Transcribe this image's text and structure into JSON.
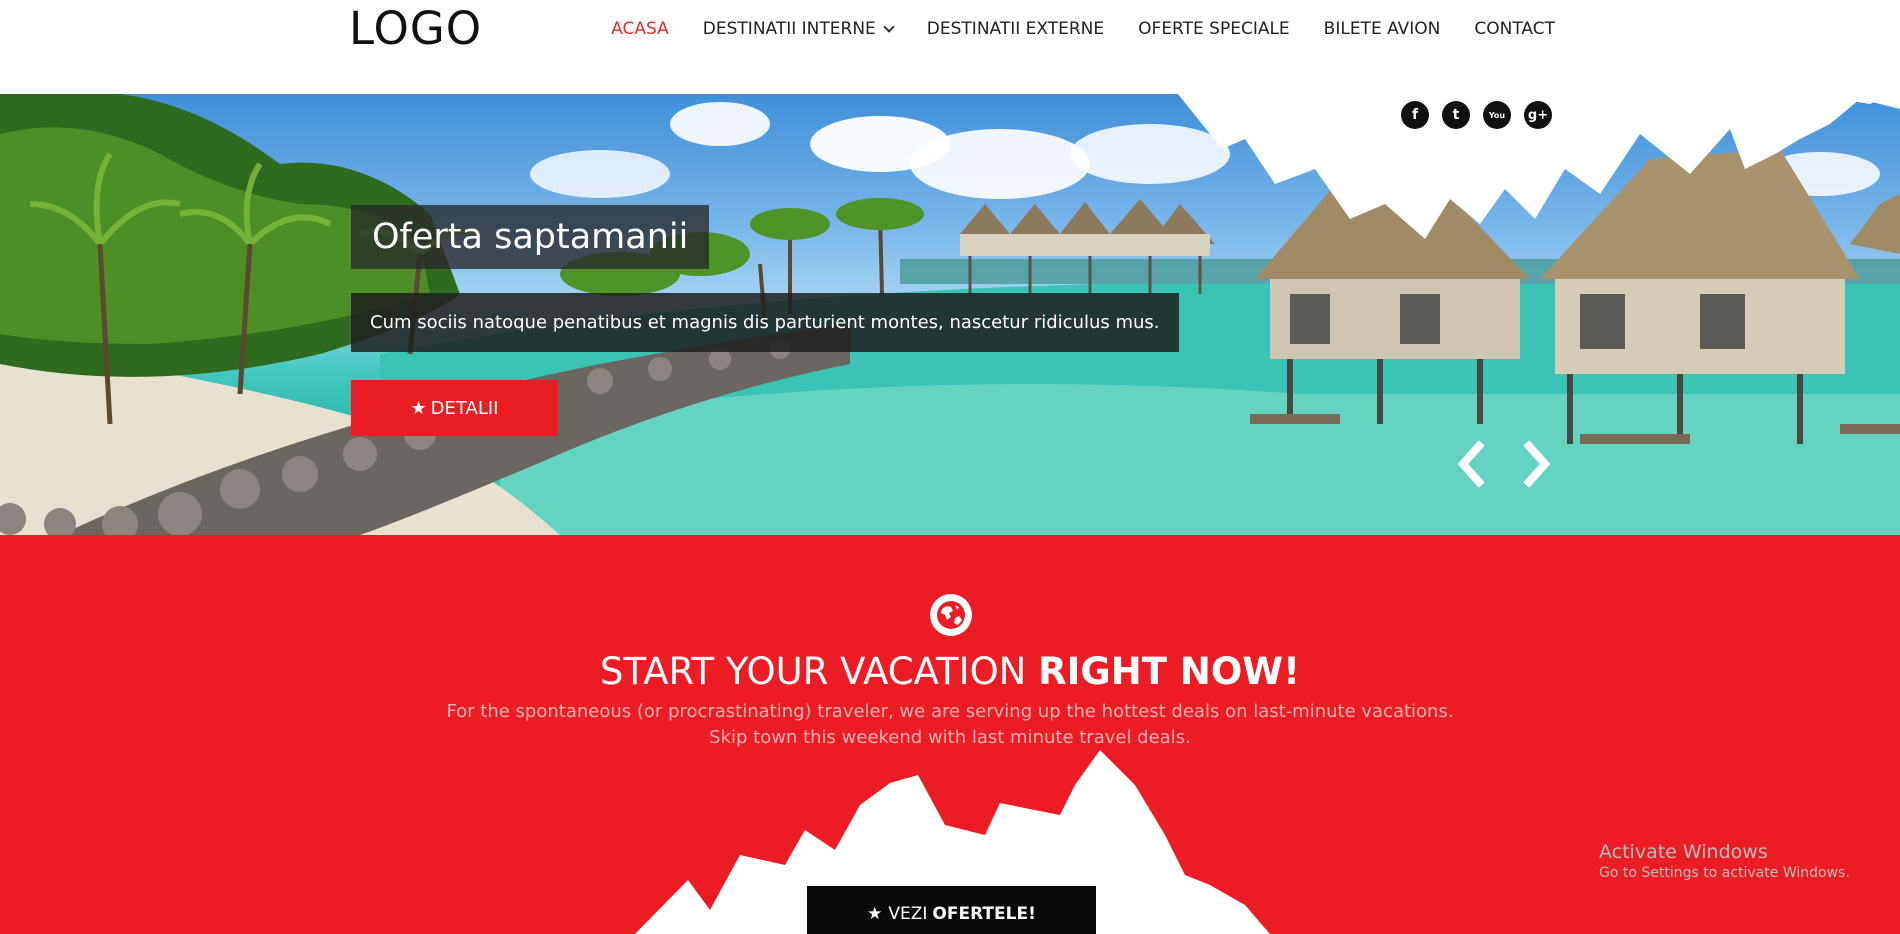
{
  "header": {
    "logo": "LOGO",
    "nav": [
      {
        "label": "ACASA",
        "active": true
      },
      {
        "label": "DESTINATII INTERNE",
        "dropdown": true
      },
      {
        "label": "DESTINATII EXTERNE"
      },
      {
        "label": "OFERTE SPECIALE"
      },
      {
        "label": "BILETE AVION"
      },
      {
        "label": "CONTACT"
      }
    ]
  },
  "social": {
    "facebook": "f",
    "twitter": "t",
    "youtube": "You",
    "googleplus": "g+"
  },
  "hero": {
    "title": "Oferta saptamanii",
    "description": "Cum sociis natoque penatibus et magnis dis parturient montes, nascetur ridiculus mus.",
    "button_icon": "★",
    "button_label": "DETALII"
  },
  "promo": {
    "headline_light": "START YOUR VACATION ",
    "headline_bold": "RIGHT NOW!",
    "line1": "For the spontaneous (or procrastinating) traveler, we are serving up the hottest deals on last-minute vacations.",
    "line2": "Skip town this weekend with last minute travel deals.",
    "button_icon": "★",
    "button_light": "VEZI",
    "button_bold": "OFERTELE!"
  },
  "windows_watermark": {
    "title": "Activate Windows",
    "subtitle": "Go to Settings to activate Windows."
  },
  "colors": {
    "accent": "#ec1c24",
    "active_nav": "#e52b2b"
  },
  "icons": [
    "globe-icon",
    "star-icon",
    "chevron-left-icon",
    "chevron-right-icon",
    "facebook-icon",
    "twitter-icon",
    "youtube-icon",
    "google-plus-icon",
    "chevron-down-icon"
  ]
}
